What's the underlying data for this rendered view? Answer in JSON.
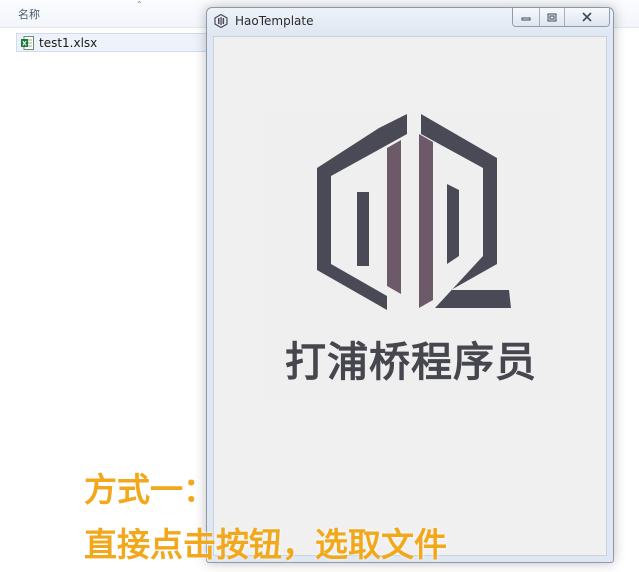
{
  "explorer": {
    "column_header": "名称",
    "files": [
      {
        "name": "test1.xlsx",
        "icon": "excel-file-icon"
      }
    ]
  },
  "window": {
    "title": "HaoTemplate",
    "icon": "hao-logo-icon",
    "buttons": [
      "minimize-icon",
      "maximize-icon",
      "close-icon"
    ]
  },
  "brand": {
    "name": "打浦桥程序员",
    "logo_color": "#4a4a56",
    "accent_color": "#6d5a68"
  },
  "caption": {
    "line1": "方式一：",
    "line2": "直接点击按钮，选取文件",
    "color": "#f2a81c"
  }
}
